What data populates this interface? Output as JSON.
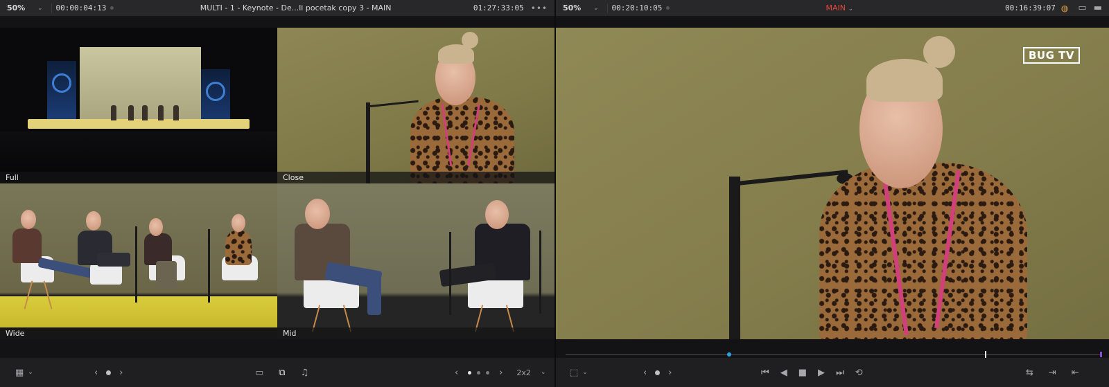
{
  "left": {
    "zoom": "50%",
    "timecode_left": "00:00:04:13",
    "title": "MULTI - 1 - Keynote - De...li pocetak copy 3 - MAIN",
    "timecode_right": "01:27:33:05",
    "more": "•••",
    "angles": [
      {
        "label": "Full"
      },
      {
        "label": "Close"
      },
      {
        "label": "Wide"
      },
      {
        "label": "Mid"
      }
    ],
    "layout": "2x2"
  },
  "right": {
    "zoom": "50%",
    "timecode_left": "00:20:10:05",
    "title": "MAIN",
    "timecode_right": "00:16:39:07",
    "logo": "BUG TV",
    "accent": "#e3453b"
  },
  "colors": {
    "active_angle": "#2aa4e0",
    "background": "#1c1c1f"
  }
}
